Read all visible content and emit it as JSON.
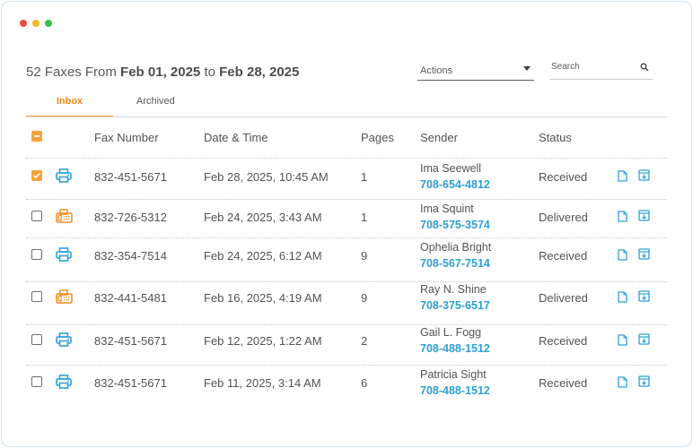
{
  "window": {
    "dot_colors": [
      "#ee4b3e",
      "#f6b62a",
      "#35c34a"
    ]
  },
  "header": {
    "count_text": "52 Faxes From",
    "start_date": "Feb 01, 2025",
    "connector": "to",
    "end_date": "Feb 28, 2025"
  },
  "actions": {
    "label": "Actions"
  },
  "search": {
    "placeholder": "Search",
    "value": ""
  },
  "tabs": [
    {
      "label": "Inbox",
      "active": true
    },
    {
      "label": "Archived",
      "active": false
    }
  ],
  "table": {
    "columns": [
      "Fax Number",
      "Date & Time",
      "Pages",
      "Sender",
      "Status"
    ],
    "rows": [
      {
        "checked": true,
        "icon": "printer-icon",
        "fax": "832-451-5671",
        "datetime": "Feb 28, 2025, 10:45 AM",
        "pages": "1",
        "sender_name": "Ima Seewell",
        "sender_phone": "708-654-4812",
        "status": "Received"
      },
      {
        "checked": false,
        "icon": "fax-machine-icon",
        "fax": "832-726-5312",
        "datetime": "Feb 24, 2025, 3:43 AM",
        "pages": "1",
        "sender_name": "Ima Squint",
        "sender_phone": "708-575-3574",
        "status": "Delivered"
      },
      {
        "checked": false,
        "icon": "printer-icon",
        "fax": "832-354-7514",
        "datetime": "Feb 24, 2025, 6:12 AM",
        "pages": "9",
        "sender_name": "Ophelia Bright",
        "sender_phone": "708-567-7514",
        "status": "Received"
      },
      {
        "checked": false,
        "icon": "fax-machine-icon",
        "fax": "832-441-5481",
        "datetime": "Feb 16, 2025, 4:19 AM",
        "pages": "9",
        "sender_name": "Ray N. Shine",
        "sender_phone": "708-375-6517",
        "status": "Delivered"
      },
      {
        "checked": false,
        "icon": "printer-icon",
        "fax": "832-451-5671",
        "datetime": "Feb 12, 2025, 1:22 AM",
        "pages": "2",
        "sender_name": "Gail L. Fogg",
        "sender_phone": "708-488-1512",
        "status": "Received"
      },
      {
        "checked": false,
        "icon": "printer-icon",
        "fax": "832-451-5671",
        "datetime": "Feb 11, 2025, 3:14 AM",
        "pages": "6",
        "sender_name": "Patricia Sight",
        "sender_phone": "708-488-1512",
        "status": "Received"
      }
    ]
  },
  "colors": {
    "accent": "#f5a23a",
    "link": "#2ea0d6",
    "fax_icon": "#f08b1b"
  }
}
